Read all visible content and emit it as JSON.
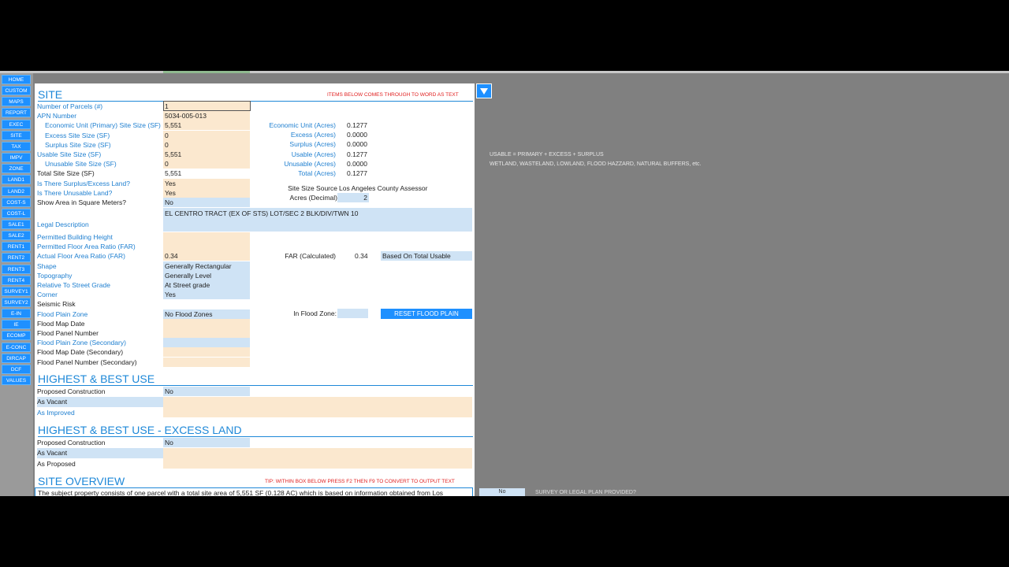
{
  "nav": [
    "HOME",
    "CUSTOM",
    "MAPS",
    "REPORT",
    "EXEC",
    "SITE",
    "TAX",
    "IMPV",
    "ZONE",
    "LAND1",
    "LAND2",
    "COST-S",
    "COST-L",
    "SALE1",
    "SALE2",
    "RENT1",
    "RENT2",
    "RENT3",
    "RENT4",
    "SURVEY1",
    "SURVEY2",
    "E-IN",
    "IE",
    "ECOMP",
    "E-CONC",
    "DIRCAP",
    "DCF",
    "VALUES"
  ],
  "site": {
    "title": "SITE",
    "note": "ITEMS BELOW COMES THROUGH TO WORD AS TEXT",
    "rows": [
      {
        "label": "Number of Parcels (#)",
        "value": "1"
      },
      {
        "label": "APN Number",
        "value": "5034-005-013"
      },
      {
        "label": "Economic Unit (Primary) Site Size (SF)",
        "value": "5,551"
      },
      {
        "label": "Excess Site Size (SF)",
        "value": "0"
      },
      {
        "label": "Surplus Site Size (SF)",
        "value": "0"
      },
      {
        "label": "Usable Site Size (SF)",
        "value": "5,551"
      },
      {
        "label": "Unusable Site Size (SF)",
        "value": "0"
      },
      {
        "label": "Total Site Size (SF)",
        "value": "5,551"
      },
      {
        "label": "Is There Surplus/Excess Land?",
        "value": "Yes"
      },
      {
        "label": "Is There Unusable Land?",
        "value": "Yes"
      },
      {
        "label": "Show Area in Square Meters?",
        "value": "No"
      }
    ],
    "acres": [
      {
        "label": "Economic Unit (Acres)",
        "value": "0.1277"
      },
      {
        "label": "Excess (Acres)",
        "value": "0.0000"
      },
      {
        "label": "Surplus (Acres)",
        "value": "0.0000"
      },
      {
        "label": "Usable (Acres)",
        "value": "0.1277"
      },
      {
        "label": "Unusable (Acres)",
        "value": "0.0000"
      },
      {
        "label": "Total (Acres)",
        "value": "0.1277"
      }
    ],
    "site_size_source_label": "Site Size Source",
    "site_size_source": "Los Angeles County Assessor",
    "acres_decimal_label": "Acres (Decimal)",
    "acres_decimal": "2",
    "legal_label": "Legal Description",
    "legal_value": "EL CENTRO TRACT (EX OF STS) LOT/SEC 2 BLK/DIV/TWN 10",
    "rows2": [
      {
        "label": "Permitted Building Height",
        "value": ""
      },
      {
        "label": "Permitted Floor Area Ratio (FAR)",
        "value": ""
      },
      {
        "label": "Actual Floor Area Ratio (FAR)",
        "value": "0.34"
      },
      {
        "label": "Shape",
        "value": "Generally Rectangular"
      },
      {
        "label": "Topography",
        "value": "Generally Level"
      },
      {
        "label": "Relative To Street Grade",
        "value": "At Street grade"
      },
      {
        "label": "Corner",
        "value": "Yes"
      },
      {
        "label": "Seismic Risk",
        "value": ""
      },
      {
        "label": "Flood Plain Zone",
        "value": "No Flood Zones"
      },
      {
        "label": "Flood Map Date",
        "value": ""
      },
      {
        "label": "Flood Panel Number",
        "value": ""
      },
      {
        "label": "Flood Plain Zone (Secondary)",
        "value": ""
      },
      {
        "label": "Flood Map Date (Secondary)",
        "value": ""
      },
      {
        "label": "Flood Panel Number (Secondary)",
        "value": ""
      }
    ],
    "far_calc_label": "FAR (Calculated)",
    "far_calc": "0.34",
    "far_basis": "Based On Total Usable",
    "in_flood_zone_label": "In Flood Zone:",
    "in_flood_zone": "",
    "reset_button": "RESET FLOOD PLAIN"
  },
  "hbu": {
    "title": "HIGHEST & BEST USE",
    "proposed_label": "Proposed Construction",
    "proposed_value": "No",
    "vacant_label": "As Vacant",
    "improved_label": "As Improved"
  },
  "hbu_excess": {
    "title": "HIGHEST & BEST USE - EXCESS LAND",
    "proposed_label": "Proposed Construction",
    "proposed_value": "No",
    "vacant_label": "As Vacant",
    "proposed2_label": "As Proposed"
  },
  "overview": {
    "title": "SITE OVERVIEW",
    "note": "TIP: WITHIN BOX BELOW PRESS F2 THEN F9 TO CONVERT TO OUTPUT TEXT",
    "text": "The subject property consists of one parcel with a total site area of 5,551 SF (0.128 AC) which is based on information obtained from Los"
  },
  "right": {
    "usable_note": "USABLE = PRIMARY + EXCESS + SURPLUS",
    "unusable_note": "WETLAND, WASTELAND, LOWLAND, FLOOD HAZZARD, NATURAL BUFFERS, etc.",
    "survey_value": "No",
    "survey_label": "SURVEY OR LEGAL PLAN PROVIDED?"
  }
}
